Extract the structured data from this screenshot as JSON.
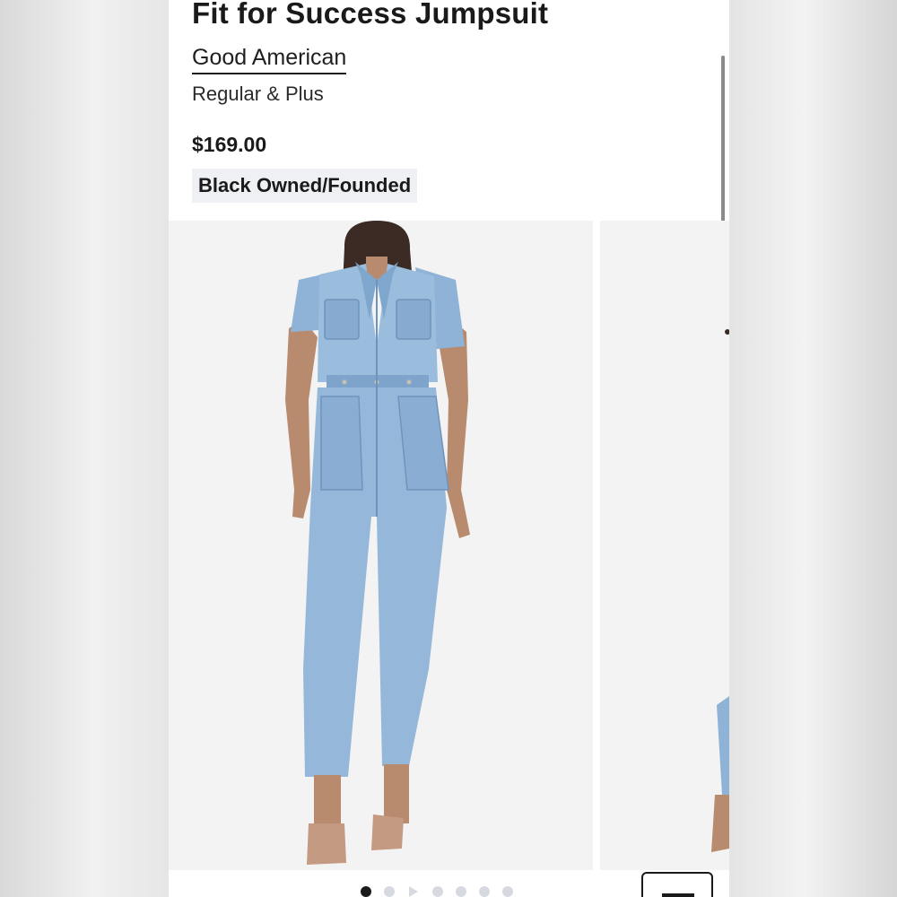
{
  "product": {
    "title": "Fit for Success Jumpsuit",
    "brand": "Good American",
    "size_range": "Regular & Plus",
    "price": "$169.00",
    "badge": "Black Owned/Founded"
  },
  "carousel": {
    "slide_count": 7,
    "active_index": 1,
    "video_index": 3
  },
  "colors": {
    "text": "#1a1a1a",
    "badge_bg": "#eef0f3",
    "dot_inactive": "#d6dae0",
    "denim": "#8fb3d6"
  }
}
